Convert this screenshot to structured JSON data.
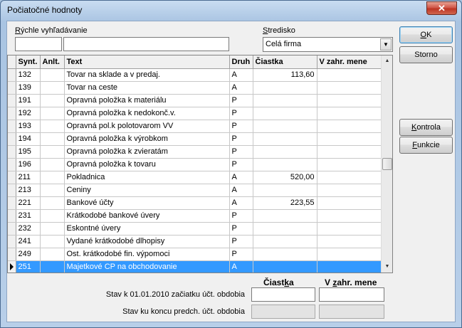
{
  "window": {
    "title": "Počiatočné hodnoty",
    "close_glyph": "✕"
  },
  "search": {
    "label_u": "R",
    "label_rest": "ýchle vyhľadávanie",
    "value1": "",
    "value2": ""
  },
  "stredisko": {
    "label_u": "S",
    "label_rest": "tredisko",
    "value": "Celá firma"
  },
  "buttons": {
    "ok_u": "O",
    "ok_rest": "K",
    "storno": "Storno",
    "kontrola_u": "K",
    "kontrola_rest": "ontrola",
    "funkcie_u": "F",
    "funkcie_rest": "unkcie"
  },
  "table": {
    "columns": [
      "Synt.",
      "Anlt.",
      "Text",
      "Druh",
      "Čiastka",
      "V zahr. mene"
    ],
    "rows": [
      {
        "synt": "132",
        "anlt": "",
        "text": "Tovar na sklade a v predaj.",
        "druh": "A",
        "ciastka": "113,60",
        "zahr": ""
      },
      {
        "synt": "139",
        "anlt": "",
        "text": "Tovar na ceste",
        "druh": "A",
        "ciastka": "",
        "zahr": ""
      },
      {
        "synt": "191",
        "anlt": "",
        "text": "Opravná položka k materiálu",
        "druh": "P",
        "ciastka": "",
        "zahr": ""
      },
      {
        "synt": "192",
        "anlt": "",
        "text": "Opravná položka k nedokonč.v.",
        "druh": "P",
        "ciastka": "",
        "zahr": ""
      },
      {
        "synt": "193",
        "anlt": "",
        "text": "Opravná pol.k polotovarom VV",
        "druh": "P",
        "ciastka": "",
        "zahr": ""
      },
      {
        "synt": "194",
        "anlt": "",
        "text": "Opravná položka k výrobkom",
        "druh": "P",
        "ciastka": "",
        "zahr": ""
      },
      {
        "synt": "195",
        "anlt": "",
        "text": "Opravná položka k zvieratám",
        "druh": "P",
        "ciastka": "",
        "zahr": ""
      },
      {
        "synt": "196",
        "anlt": "",
        "text": "Opravná položka k tovaru",
        "druh": "P",
        "ciastka": "",
        "zahr": ""
      },
      {
        "synt": "211",
        "anlt": "",
        "text": "Pokladnica",
        "druh": "A",
        "ciastka": "520,00",
        "zahr": ""
      },
      {
        "synt": "213",
        "anlt": "",
        "text": "Ceniny",
        "druh": "A",
        "ciastka": "",
        "zahr": ""
      },
      {
        "synt": "221",
        "anlt": "",
        "text": "Bankové účty",
        "druh": "A",
        "ciastka": "223,55",
        "zahr": ""
      },
      {
        "synt": "231",
        "anlt": "",
        "text": "Krátkodobé bankové úvery",
        "druh": "P",
        "ciastka": "",
        "zahr": ""
      },
      {
        "synt": "232",
        "anlt": "",
        "text": "Eskontné úvery",
        "druh": "P",
        "ciastka": "",
        "zahr": ""
      },
      {
        "synt": "241",
        "anlt": "",
        "text": "Vydané krátkodobé dlhopisy",
        "druh": "P",
        "ciastka": "",
        "zahr": ""
      },
      {
        "synt": "249",
        "anlt": "",
        "text": "Ost. krátkodobé fin. výpomoci",
        "druh": "P",
        "ciastka": "",
        "zahr": ""
      },
      {
        "synt": "251",
        "anlt": "",
        "text": "Majetkové CP na obchodovanie",
        "druh": "A",
        "ciastka": "",
        "zahr": "",
        "selected": true
      }
    ],
    "scroll_position": 0.5,
    "scroll_up_glyph": "▲",
    "scroll_down_glyph": "▼"
  },
  "summary": {
    "col_ciastka_pre": "Čiast",
    "col_ciastka_u": "k",
    "col_ciastka_post": "a",
    "col_zahr_pre": "V ",
    "col_zahr_u": "z",
    "col_zahr_post": "ahr. mene",
    "row1_label": "Stav k 01.01.2010 začiatku účt. obdobia",
    "row1_ciastka": "",
    "row1_zahr": "",
    "row2_label": "Stav ku koncu predch. účt. obdobia",
    "row2_ciastka": "",
    "row2_zahr": ""
  }
}
